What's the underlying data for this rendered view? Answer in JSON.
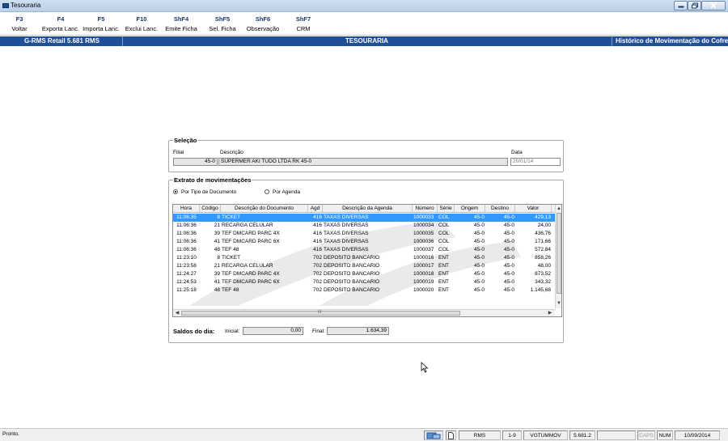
{
  "window": {
    "title": "Tesouraria"
  },
  "toolbar": {
    "keys": [
      {
        "key": "F3",
        "label": "Voltar"
      },
      {
        "key": "F4",
        "label": "Exporta Lanc."
      },
      {
        "key": "F5",
        "label": "Importa Lanc."
      },
      {
        "key": "F10",
        "label": "Exclui Lanc."
      },
      {
        "key": "ShF4",
        "label": "Emite Ficha"
      },
      {
        "key": "ShF5",
        "label": "Sel. Ficha"
      },
      {
        "key": "ShF6",
        "label": "Observação"
      },
      {
        "key": "ShF7",
        "label": "CRM"
      }
    ]
  },
  "header": {
    "app_version": "G-RMS Retail 5.681 RMS",
    "module": "TESOURARIA",
    "screen": "Histórico de Movimentação do Cofre"
  },
  "selecao": {
    "title": "Seleção",
    "filial_label": "Filial",
    "filial_value": "45-0",
    "descricao_label": "Descrição",
    "descricao_value": "SUPERMER AKI TUDO LTDA RK 45-0",
    "data_label": "Data",
    "data_value": "20/01/14"
  },
  "extrato": {
    "title": "Extrato de movimentações",
    "radio_tipo": "Por Tipo de Documento",
    "radio_agenda": "Por Agenda",
    "selected": "tipo",
    "columns": [
      "Hora",
      "Código",
      "Descrição do Documento",
      "Agd",
      "Descrição da Agenda",
      "Número",
      "Série",
      "Origem",
      "Destino",
      "Valor"
    ],
    "rows": [
      [
        "11:06:35",
        "8",
        "TICKET",
        "416",
        "TAXAS DIVERSAS",
        "1000033",
        "COL",
        "45-0",
        "45-0",
        "429,13"
      ],
      [
        "11:06:36",
        "21",
        "RECARGA CELULAR",
        "416",
        "TAXAS DIVERSAS",
        "1000034",
        "COL",
        "45-0",
        "45-0",
        "24,00"
      ],
      [
        "11:06:36",
        "39",
        "TEF DMCARD PARC 4X",
        "416",
        "TAXAS DIVERSAS",
        "1000035",
        "COL",
        "45-0",
        "45-0",
        "436,76"
      ],
      [
        "11:06:36",
        "41",
        "TEF DMCARD PARC 6X",
        "416",
        "TAXAS DIVERSAS",
        "1000036",
        "COL",
        "45-0",
        "45-0",
        "171,66"
      ],
      [
        "11:06:36",
        "48",
        "TEF 48",
        "416",
        "TAXAS DIVERSAS",
        "1000037",
        "COL",
        "45-0",
        "45-0",
        "572,84"
      ],
      [
        "11:23:10",
        "8",
        "TICKET",
        "702",
        "DEPOSITO BANCARIO",
        "1000016",
        "ENT",
        "45-0",
        "45-0",
        "858,26"
      ],
      [
        "11:23:58",
        "21",
        "RECARGA CELULAR",
        "702",
        "DEPOSITO BANCARIO",
        "1000017",
        "ENT",
        "45-0",
        "45-0",
        "48,00"
      ],
      [
        "11:24:27",
        "39",
        "TEF DMCARD PARC 4X",
        "702",
        "DEPOSITO BANCARIO",
        "1000018",
        "ENT",
        "45-0",
        "45-0",
        "873,52"
      ],
      [
        "11:24:53",
        "41",
        "TEF DMCARD PARC 6X",
        "702",
        "DEPOSITO BANCARIO",
        "1000019",
        "ENT",
        "45-0",
        "45-0",
        "343,32"
      ],
      [
        "11:25:18",
        "48",
        "TEF 48",
        "702",
        "DEPOSITO BANCARIO",
        "1000020",
        "ENT",
        "45-0",
        "45-0",
        "1.145,68"
      ]
    ],
    "scroll_mid_label": "III"
  },
  "saldos": {
    "label": "Saldos do dia:",
    "inicial_label": "Inicial:",
    "inicial_value": "0,00",
    "final_label": "Final:",
    "final_value": "1.634,39"
  },
  "statusbar": {
    "message": "Pronto.",
    "user": "RMS",
    "page": "1-9",
    "host": "VGTUMMOV",
    "version": "5.681.2",
    "caps": "CAPS",
    "num": "NUM",
    "date": "10/09/2014"
  },
  "colors": {
    "header_blue": "#1f4f96",
    "selection_blue": "#3399ff"
  }
}
